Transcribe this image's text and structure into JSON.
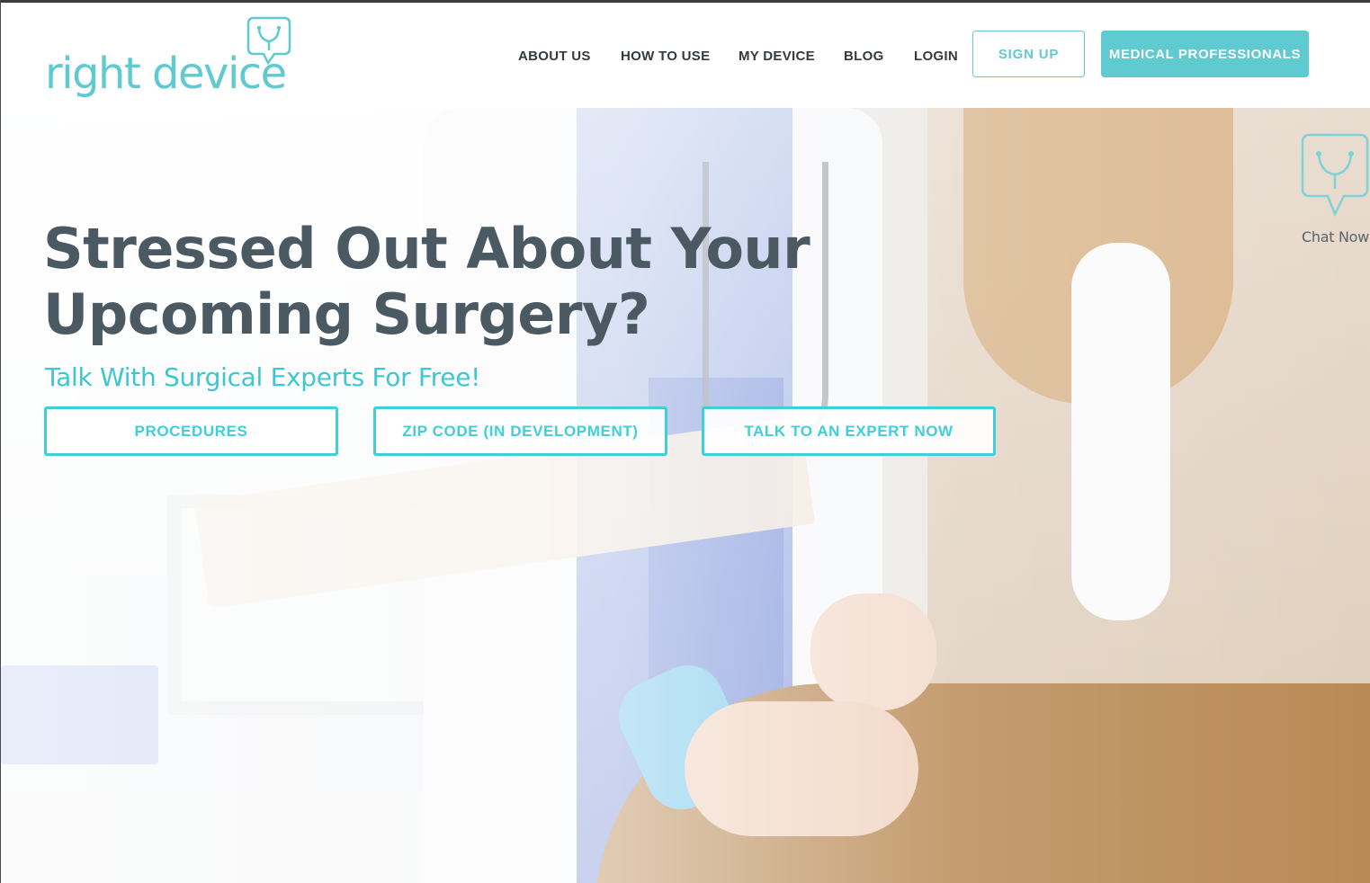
{
  "brand": {
    "name": "right device",
    "accent_color": "#5fcad0",
    "cta_color": "#3ecfd8",
    "logo_icon": "stethoscope-chat-bubble-icon"
  },
  "nav": {
    "items": [
      {
        "label": "ABOUT US"
      },
      {
        "label": "HOW TO USE"
      },
      {
        "label": "MY DEVICE"
      },
      {
        "label": "BLOG"
      },
      {
        "label": "LOGIN"
      }
    ],
    "signup_label": "SIGN UP",
    "medical_professionals_label": "MEDICAL PROFESSIONALS"
  },
  "chat_widget": {
    "icon": "stethoscope-chat-bubble-icon",
    "label": "Chat Now"
  },
  "hero": {
    "headline_line1": "Stressed Out About Your",
    "headline_line2": "Upcoming Surgery?",
    "subheadline": "Talk With Surgical Experts For Free!",
    "buttons": [
      {
        "label": "PROCEDURES"
      },
      {
        "label": "ZIP CODE (IN DEVELOPMENT)"
      },
      {
        "label": "TALK TO AN EXPERT NOW"
      }
    ],
    "background_image": "doctor-consulting-patient-photo"
  }
}
